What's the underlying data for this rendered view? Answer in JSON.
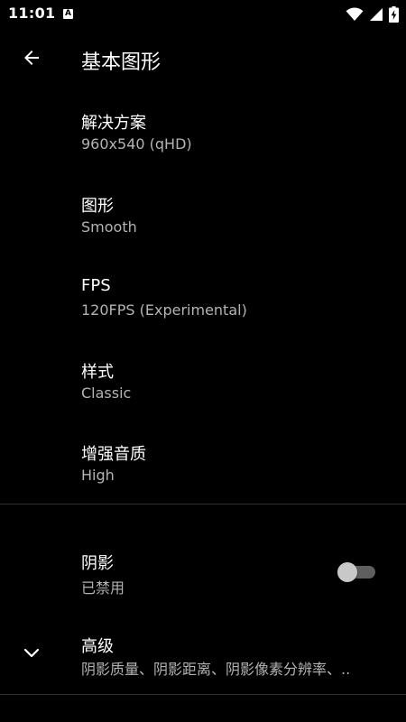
{
  "status_bar": {
    "time": "11:01",
    "notification_icon_letter": "A",
    "icons": [
      "wifi-icon",
      "cellular-signal-icon",
      "battery-charging-icon"
    ]
  },
  "app_bar": {
    "back_icon": "arrow-left-icon",
    "title": "基本图形"
  },
  "preferences": [
    {
      "title": "解决方案",
      "summary": "960x540 (qHD)"
    },
    {
      "title": "图形",
      "summary": "Smooth"
    },
    {
      "title": "FPS",
      "summary": "120FPS (Experimental)"
    },
    {
      "title": "样式",
      "summary": "Classic"
    },
    {
      "title": "增强音质",
      "summary": "High"
    }
  ],
  "shadow": {
    "title": "阴影",
    "summary": "已禁用",
    "switch_on": false
  },
  "advanced": {
    "icon": "chevron-down-icon",
    "title": "高级",
    "summary": "阴影质量、阴影距离、阴影像素分辨率、.."
  },
  "colors": {
    "background": "#000000",
    "text_primary": "#ffffff",
    "text_secondary": "#b3b3b3",
    "divider": "#2e2e2e",
    "switch_thumb_off": "#c8c8c8",
    "switch_track_off": "#5f5f5f"
  }
}
